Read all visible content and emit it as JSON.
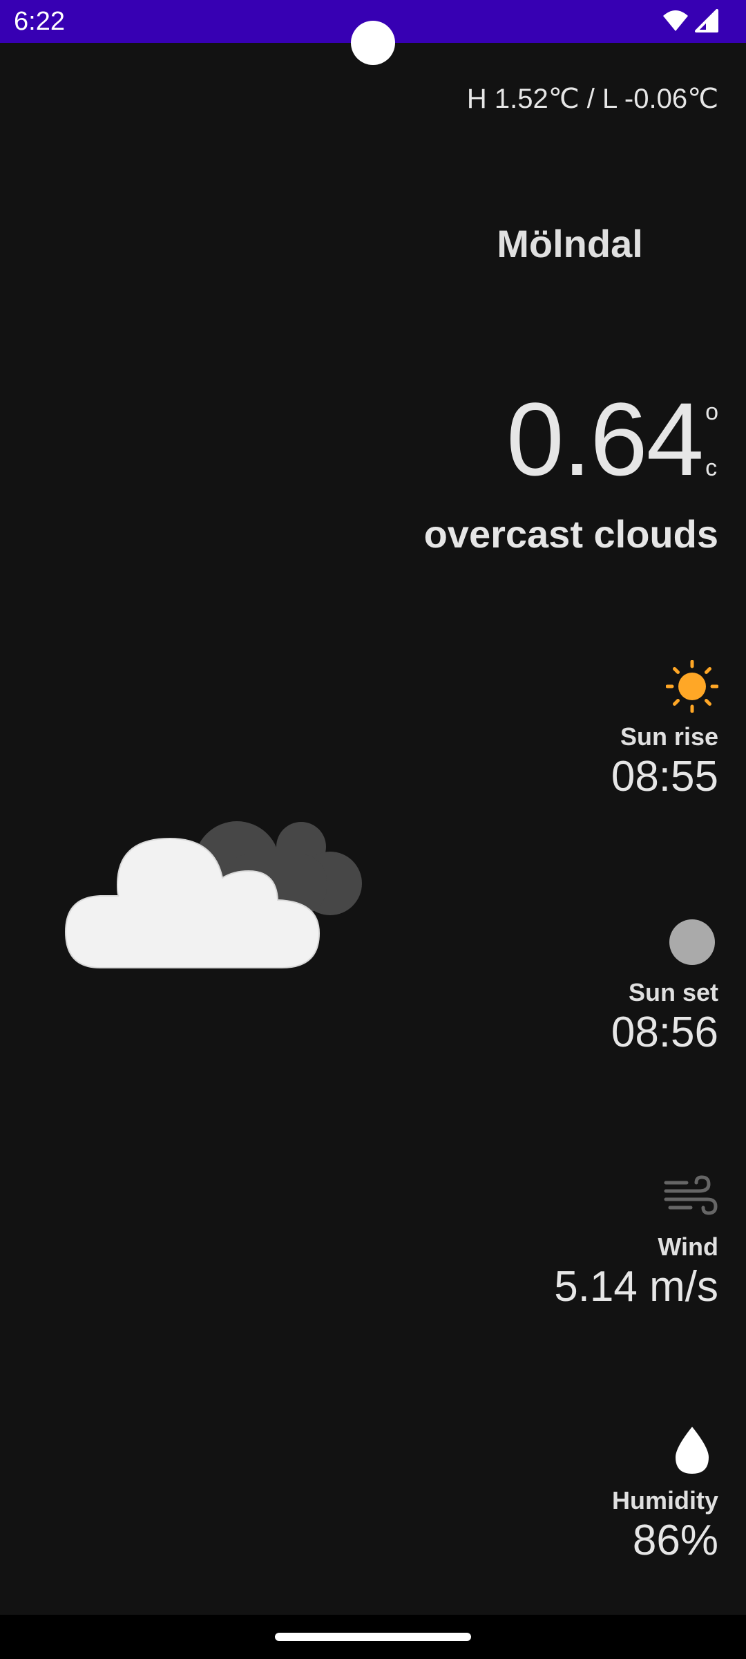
{
  "status_bar": {
    "time": "6:22",
    "color": "#3700b3",
    "icons": [
      "wifi-icon",
      "cellular-signal-icon"
    ]
  },
  "weather": {
    "high_low": "H 1.52℃ / L -0.06℃",
    "city": "Mölndal",
    "temperature": "0.64",
    "unit_degree": "o",
    "unit_c": "c",
    "condition": "overcast clouds",
    "condition_icon": "overcast-clouds-icon"
  },
  "details": [
    {
      "id": "sunrise",
      "label": "Sun rise",
      "value": "08:55",
      "icon": "sun-icon",
      "icon_color": "#ffa726"
    },
    {
      "id": "sunset",
      "label": "Sun set",
      "value": "08:56",
      "icon": "moon-icon",
      "icon_color": "#aaaaaa"
    },
    {
      "id": "wind",
      "label": "Wind",
      "value": "5.14 m/s",
      "icon": "wind-icon",
      "icon_color": "#666666"
    },
    {
      "id": "humidity",
      "label": "Humidity",
      "value": "86%",
      "icon": "water-drop-icon",
      "icon_color": "#ffffff"
    }
  ],
  "colors": {
    "background": "#121212",
    "text": "#e6e6e6"
  }
}
